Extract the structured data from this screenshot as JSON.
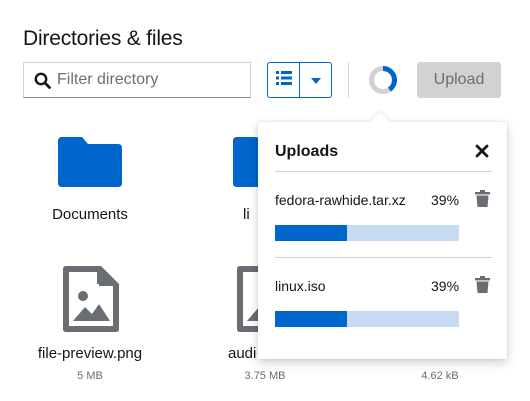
{
  "header": {
    "title": "Directories & files"
  },
  "toolbar": {
    "filter_placeholder": "Filter directory",
    "filter_value": "",
    "upload_label": "Upload",
    "upload_in_progress": true,
    "view_mode": "list",
    "icons": {
      "search": "search-icon",
      "list": "list-icon",
      "dropdown": "caret-down-icon",
      "progress": "circular-progress-icon"
    }
  },
  "files": [
    {
      "name": "Documents",
      "type": "folder",
      "size": ""
    },
    {
      "name": "li",
      "type": "folder",
      "size": ""
    },
    {
      "name": "file-preview.png",
      "type": "image",
      "size": "5 MB"
    },
    {
      "name": "audi",
      "type": "image",
      "size": "3.75 MB"
    },
    {
      "name": "",
      "type": "hidden",
      "size": "4.62 kB"
    }
  ],
  "uploads_popover": {
    "title": "Uploads",
    "items": [
      {
        "name": "fedora-rawhide.tar.xz",
        "percent_label": "39%",
        "progress": 0.39
      },
      {
        "name": "linux.iso",
        "percent_label": "39%",
        "progress": 0.39
      }
    ]
  },
  "colors": {
    "accent": "#0066cc",
    "progress_track": "#c7dcf2",
    "folder": "#0066cc",
    "file_icon": "#6a6e73",
    "disabled_button": "#d2d2d2"
  }
}
